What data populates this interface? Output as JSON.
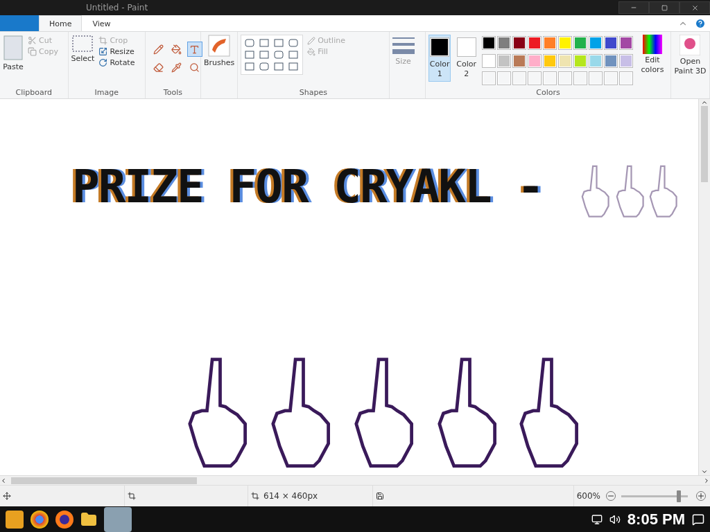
{
  "window": {
    "title": "Untitled - Paint"
  },
  "tabs": [
    {
      "label": "Home",
      "selected": true
    },
    {
      "label": "View",
      "selected": false
    }
  ],
  "clipboard": {
    "label": "Clipboard",
    "paste": "Paste",
    "items": [
      {
        "label": "Cut",
        "disabled": true
      },
      {
        "label": "Copy",
        "disabled": true
      }
    ]
  },
  "image": {
    "label": "Image",
    "select": "Select",
    "items": [
      {
        "label": "Crop",
        "disabled": true
      },
      {
        "label": "Resize",
        "disabled": false
      },
      {
        "label": "Rotate",
        "disabled": false
      }
    ]
  },
  "tools": {
    "label": "Tools",
    "items": [
      {
        "kind": "pencil",
        "selected": false
      },
      {
        "kind": "fill",
        "selected": false
      },
      {
        "kind": "text",
        "selected": true
      },
      {
        "kind": "eraser",
        "selected": false
      },
      {
        "kind": "picker",
        "selected": false
      },
      {
        "kind": "magnifier",
        "selected": false
      }
    ]
  },
  "brushes": {
    "label": "Brushes"
  },
  "shapes": {
    "label": "Shapes",
    "outline": {
      "label": "Outline",
      "disabled": true
    },
    "fill": {
      "label": "Fill",
      "disabled": true
    }
  },
  "size": {
    "label": "Size",
    "disabled": true
  },
  "colors": {
    "label": "Colors",
    "color1": {
      "label": "Color 1",
      "selected": true,
      "color": "#000000"
    },
    "color2": {
      "label": "Color 2",
      "selected": false,
      "color": "#ffffff"
    },
    "palette": [
      {
        "color": "#000000"
      },
      {
        "color": "#7f7f7f"
      },
      {
        "color": "#880015"
      },
      {
        "color": "#ed1c24"
      },
      {
        "color": "#ff7f27"
      },
      {
        "color": "#fff200"
      },
      {
        "color": "#22b14c"
      },
      {
        "color": "#00a2e8"
      },
      {
        "color": "#3f48cc"
      },
      {
        "color": "#a349a4"
      },
      {
        "color": "#ffffff"
      },
      {
        "color": "#c3c3c3"
      },
      {
        "color": "#b97a57"
      },
      {
        "color": "#ffaec9"
      },
      {
        "color": "#ffc90e"
      },
      {
        "color": "#efe4b0"
      },
      {
        "color": "#b5e61d"
      },
      {
        "color": "#99d9ea"
      },
      {
        "color": "#7092be"
      },
      {
        "color": "#c8bfe7"
      }
    ],
    "edit": "Edit colors"
  },
  "open_3d": {
    "label": "Open Paint 3D"
  },
  "canvas": {
    "text": "PRIZE FOR CRYAKL -"
  },
  "status_bar": {
    "image_size": "614 × 460px",
    "zoom": "600%",
    "zoom_level": {
      "level": 0.86
    }
  },
  "taskbar": {
    "time": "8:05 PM"
  }
}
